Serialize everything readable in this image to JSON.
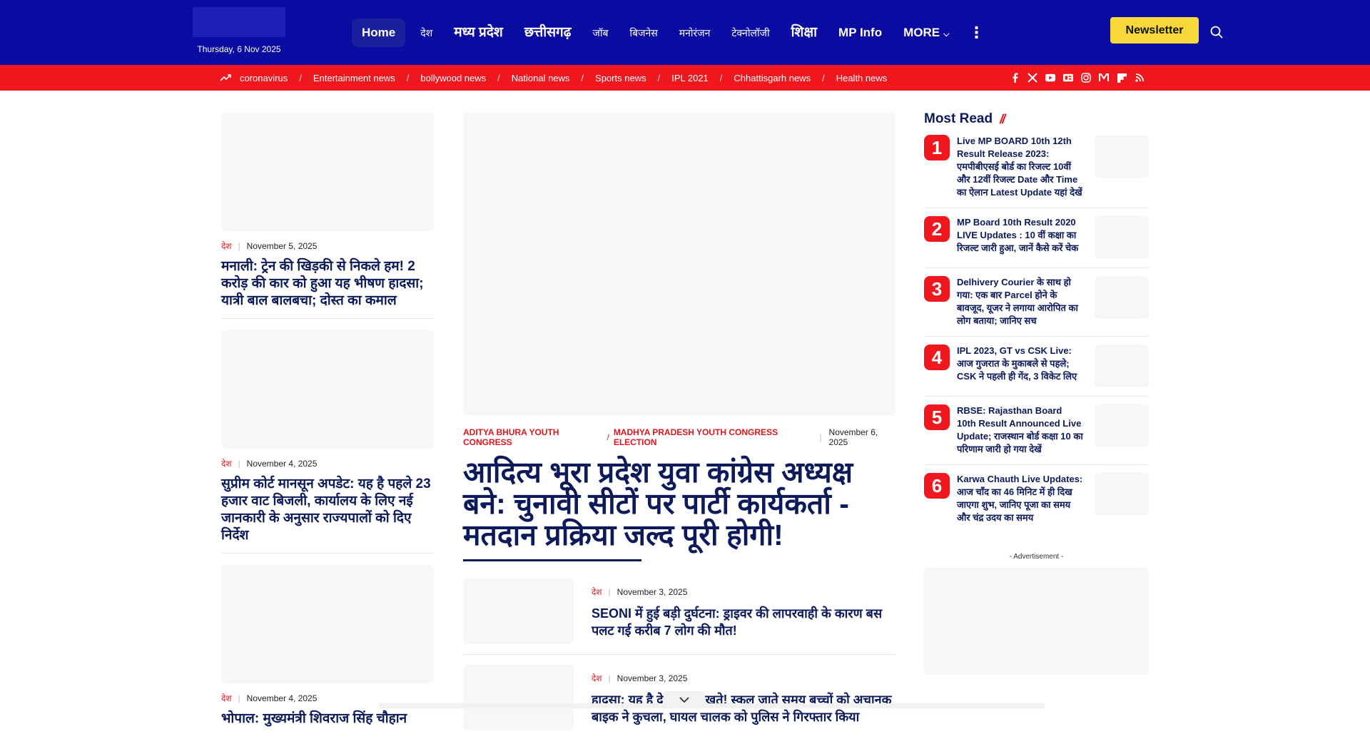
{
  "header": {
    "date": "Thursday, 6 Nov 2025",
    "nav": [
      {
        "label": "Home",
        "active": true,
        "style": "big"
      },
      {
        "label": "देश",
        "style": "small"
      },
      {
        "label": "मध्य प्रदेश",
        "style": "big"
      },
      {
        "label": "छत्तीसगढ़",
        "style": "big"
      },
      {
        "label": "जॉब",
        "style": "small"
      },
      {
        "label": "बिजनेस",
        "style": "small"
      },
      {
        "label": "मनोरंजन",
        "style": "small"
      },
      {
        "label": "टेक्नोलॉजी",
        "style": "small"
      },
      {
        "label": "शिक्षा",
        "style": "big"
      },
      {
        "label": "MP Info",
        "style": "normal"
      },
      {
        "label": "MORE",
        "style": "normal",
        "dropdown": true
      }
    ],
    "newsletter_label": "Newsletter"
  },
  "trending": {
    "icon": "trending-icon",
    "links": [
      "coronavirus",
      "Entertainment news",
      "bollywood news",
      "National news",
      "Sports news",
      "IPL 2021",
      "Chhattisgarh news",
      "Health news"
    ]
  },
  "social_icons": [
    "facebook-icon",
    "x-icon",
    "youtube-icon",
    "google-news-icon",
    "instagram-icon",
    "medium-icon",
    "flipboard-icon",
    "rss-icon"
  ],
  "left_column": [
    {
      "category": "देश",
      "date": "November 5, 2025",
      "title": "मनाली: ट्रेन की खिड़की से निकले हम! 2 करोड़ की कार को हुआ यह भीषण हादसा; यात्री बाल बालबचा; दोस्त का कमाल"
    },
    {
      "category": "देश",
      "date": "November 4, 2025",
      "title": "सुप्रीम कोर्ट मानसून अपडेट: यह है पहले 23 हजार वाट बिजली, कार्यालय के लिए नई जानकारी के अनुसार राज्यपालों को दिए निर्देश"
    },
    {
      "category": "देश",
      "date": "November 4, 2025",
      "title": "भोपाल: मुख्यमंत्री शिवराज सिंह चौहान"
    }
  ],
  "hero": {
    "category_1": "ADITYA BHURA YOUTH CONGRESS",
    "category_2": "MADHYA PRADESH YOUTH CONGRESS ELECTION",
    "date": "November 6, 2025",
    "title": "आदित्य भूरा प्रदेश युवा कांग्रेस अध्यक्ष बने: चुनावी सीटों पर पार्टी कार्यकर्ता - मतदान प्रक्रिया जल्द पूरी होगी!"
  },
  "center_list": [
    {
      "category": "देश",
      "date": "November 3, 2025",
      "title": "SEONI में हुई बड़ी दुर्घटना: ड्राइवर की लापरवाही के कारण बस पलट गई करीब 7 लोग की मौत!"
    },
    {
      "category": "देश",
      "date": "November 3, 2025",
      "title": "हादसा: यह है देखते ही देखते! स्कूल जाते समय बच्चों को अचानक बाइक ने कुचला, घायल चालक को पुलिस ने गिरफ्तार किया"
    }
  ],
  "most_read": {
    "heading": "Most Read",
    "items": [
      {
        "rank": "1",
        "title": "Live MP BOARD 10th 12th Result Release 2023: एमपीबीएसई बोर्ड का रिजल्ट 10वीं और 12वीं रिजल्ट Date और Time का ऐलान Latest Update यहां देखें"
      },
      {
        "rank": "2",
        "title": "MP Board 10th Result 2020 LIVE Updates : 10 वीं कक्षा का रिजल्ट जारी हुआ, जानें कैसे करें चेक"
      },
      {
        "rank": "3",
        "title": "Delhivery Courier के साथ हो गया: एक बार Parcel होने के बावजूद, यूजर ने लगाया आरोपित का लोग बताया; जानिए सच"
      },
      {
        "rank": "4",
        "title": "IPL 2023, GT vs CSK Live: आज गुजरात के मुकाबले से पहले; CSK ने पहली ही गेंद, 3 विकेट लिए"
      },
      {
        "rank": "5",
        "title": "RBSE: Rajasthan Board 10th Result Announced Live Update; राजस्थान बोर्ड कक्षा 10 का परिणाम जारी हो गया देखें"
      },
      {
        "rank": "6",
        "title": "Karwa Chauth Live Updates: आज चाँद का 46 मिनिट में ही दिख जाएगा शुभ, जानिए पूजा का समय और चंद्र उदय का समय"
      }
    ],
    "ad_label": "- Advertisement -"
  }
}
